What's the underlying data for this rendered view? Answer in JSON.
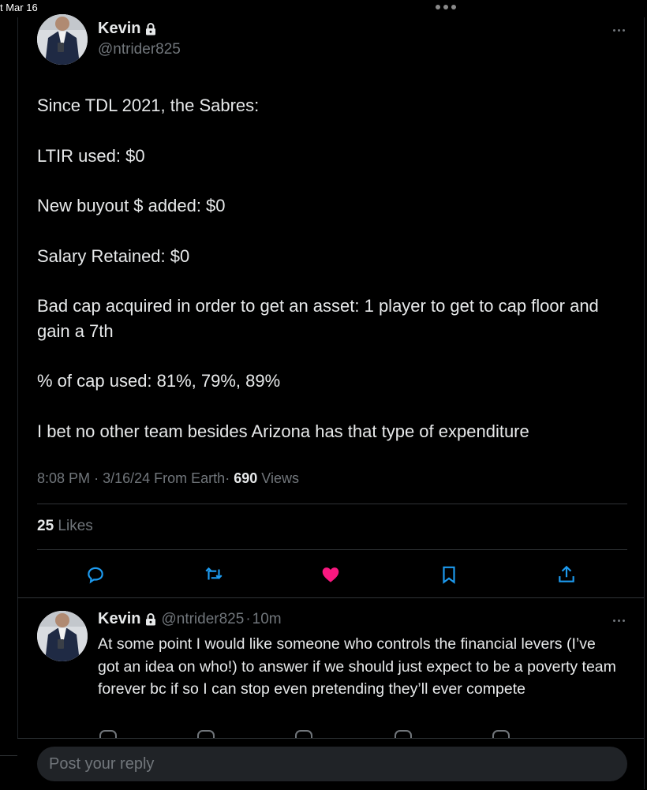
{
  "status_bar": {
    "date": "t Mar 16"
  },
  "tweet": {
    "author_name": "Kevin",
    "author_handle": "@ntrider825",
    "text_lines": [
      "Since TDL 2021, the Sabres:",
      "LTIR used: $0",
      "New buyout $ added: $0",
      "Salary Retained: $0",
      "Bad cap acquired in order to get an asset: 1 player to get to cap floor and gain a 7th",
      "% of cap used: 81%, 79%, 89%",
      "I bet no other team besides Arizona has that type of expenditure"
    ],
    "time": "8:08 PM",
    "date": "3/16/24",
    "source": "From Earth",
    "sep": "·",
    "views_count": "690",
    "views_label": "Views",
    "likes_count": "25",
    "likes_label": "Likes",
    "liked": true,
    "like_color": "#f91880"
  },
  "actions": {
    "icons": [
      "reply-icon",
      "retweet-icon",
      "like-icon",
      "bookmark-icon",
      "share-icon"
    ]
  },
  "reply": {
    "author_name": "Kevin",
    "author_handle": "@ntrider825",
    "sep": "·",
    "age": "10m",
    "text": "At some point I would like someone who controls the financial levers (I’ve got an idea on who!) to answer if we should just expect to be a poverty team forever bc if so I can stop even pretending they’ll ever compete"
  },
  "composer": {
    "placeholder": "Post your reply"
  },
  "colors": {
    "background": "#000000",
    "text": "#e7e9ea",
    "muted": "#71767b",
    "divider": "#2f3336",
    "input_bg": "#202327"
  }
}
